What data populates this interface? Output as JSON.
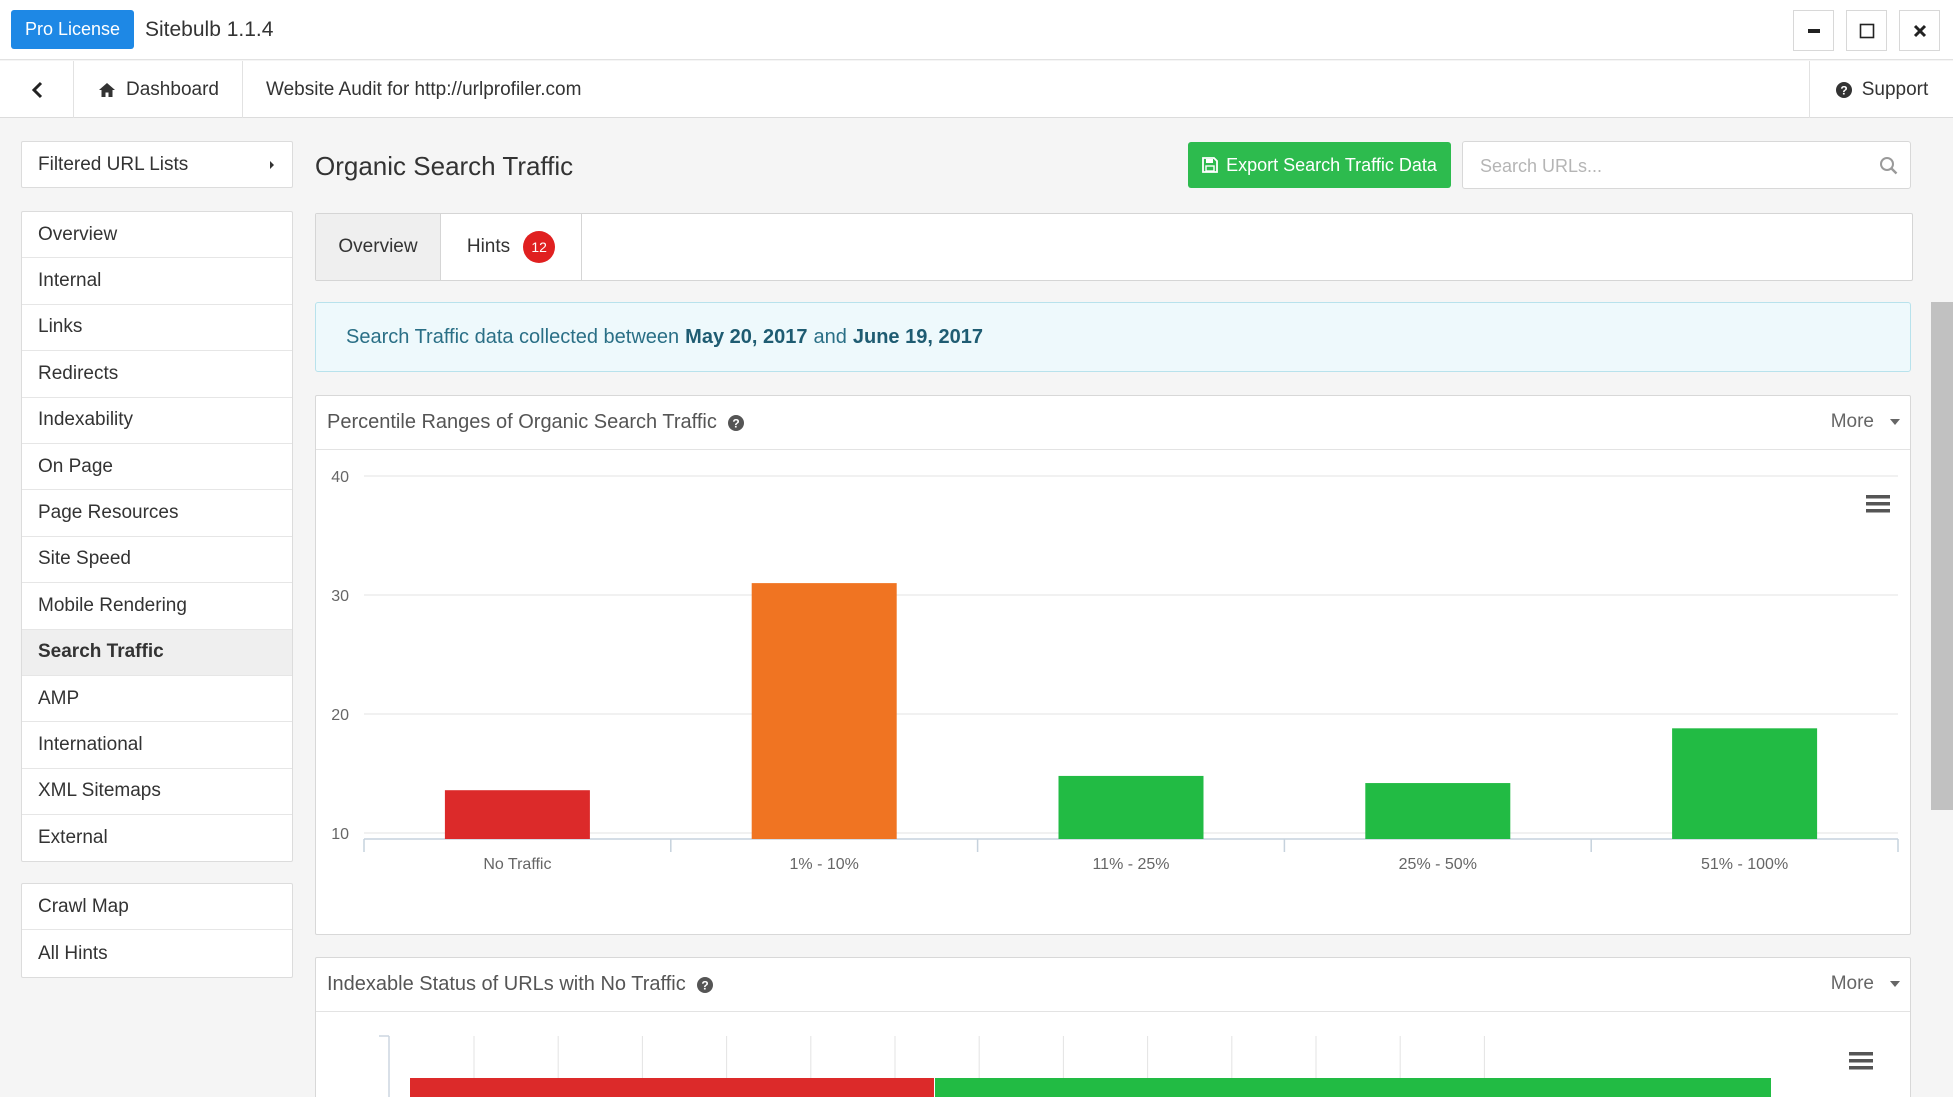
{
  "titlebar": {
    "license_label": "Pro License",
    "app_title": "Sitebulb 1.1.4"
  },
  "navbar": {
    "dashboard_label": "Dashboard",
    "audit_title": "Website Audit for http://urlprofiler.com",
    "support_label": "Support"
  },
  "sidebar": {
    "filtered_label": "Filtered URL Lists",
    "items": [
      "Overview",
      "Internal",
      "Links",
      "Redirects",
      "Indexability",
      "On Page",
      "Page Resources",
      "Site Speed",
      "Mobile Rendering",
      "Search Traffic",
      "AMP",
      "International",
      "XML Sitemaps",
      "External"
    ],
    "active_item": "Search Traffic",
    "extra_items": [
      "Crawl Map",
      "All Hints"
    ]
  },
  "header": {
    "page_title": "Organic Search Traffic",
    "export_label": "Export Search Traffic Data",
    "search_placeholder": "Search URLs..."
  },
  "tabs": {
    "overview_label": "Overview",
    "hints_label": "Hints",
    "hints_count": "12"
  },
  "alert": {
    "prefix": "Search Traffic data collected between",
    "start_date": "May 20, 2017",
    "joiner": "and",
    "end_date": "June 19, 2017"
  },
  "panel1": {
    "title": "Percentile Ranges of Organic Search Traffic",
    "more_label": "More"
  },
  "panel2": {
    "title": "Indexable Status of URLs with No Traffic",
    "more_label": "More",
    "segment_colors": [
      "#dc2a2a",
      "#22bb44"
    ]
  },
  "colors": {
    "accent": "#1e88e5",
    "export_green": "#2dbb4e",
    "badge_red": "#e02020"
  },
  "chart_data": [
    {
      "type": "bar",
      "categories": [
        "No Traffic",
        "1% - 10%",
        "11% - 25%",
        "25% - 50%",
        "51% - 100%"
      ],
      "values": [
        13.6,
        31,
        14.8,
        14.2,
        18.8
      ],
      "colors": [
        "#dc2a2a",
        "#f07422",
        "#22bb44",
        "#22bb44",
        "#22bb44"
      ],
      "yticks": [
        10,
        20,
        30,
        40
      ],
      "ylim": [
        9.5,
        40
      ],
      "grid": true
    }
  ]
}
